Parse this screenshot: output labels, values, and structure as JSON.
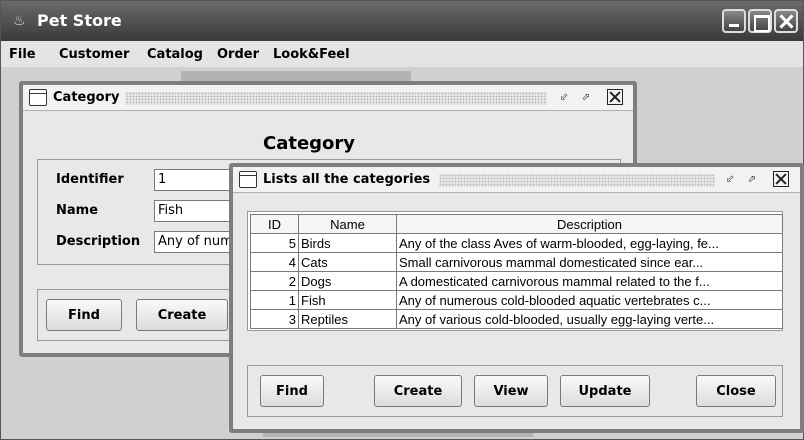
{
  "window": {
    "title": "Pet Store"
  },
  "menu": {
    "items": [
      "File",
      "Customer",
      "Catalog",
      "Order",
      "Look&Feel"
    ]
  },
  "category_frame": {
    "title": "Category",
    "heading": "Category",
    "fields": {
      "identifier_label": "Identifier",
      "identifier_value": "1",
      "name_label": "Name",
      "name_value": "Fish",
      "description_label": "Description",
      "description_value": "Any of num"
    },
    "buttons": {
      "find": "Find",
      "create": "Create"
    }
  },
  "list_frame": {
    "title": "Lists all the categories",
    "columns": [
      "ID",
      "Name",
      "Description"
    ],
    "rows": [
      {
        "id": "5",
        "name": "Birds",
        "description": "Any of the class Aves of warm-blooded, egg-laying, fe..."
      },
      {
        "id": "4",
        "name": "Cats",
        "description": " Small carnivorous mammal domesticated since ear..."
      },
      {
        "id": "2",
        "name": "Dogs",
        "description": "A domesticated carnivorous mammal related to the f..."
      },
      {
        "id": "1",
        "name": "Fish",
        "description": "Any of numerous cold-blooded aquatic vertebrates c..."
      },
      {
        "id": "3",
        "name": "Reptiles",
        "description": "Any of various cold-blooded, usually egg-laying verte..."
      }
    ],
    "buttons": {
      "find": "Find",
      "create": "Create",
      "view": "View",
      "update": "Update",
      "close": "Close"
    }
  },
  "icons": [
    "java-cup-icon",
    "minimize-icon",
    "maximize-icon",
    "close-icon",
    "frame-icon",
    "iconify-icon",
    "restore-icon"
  ]
}
